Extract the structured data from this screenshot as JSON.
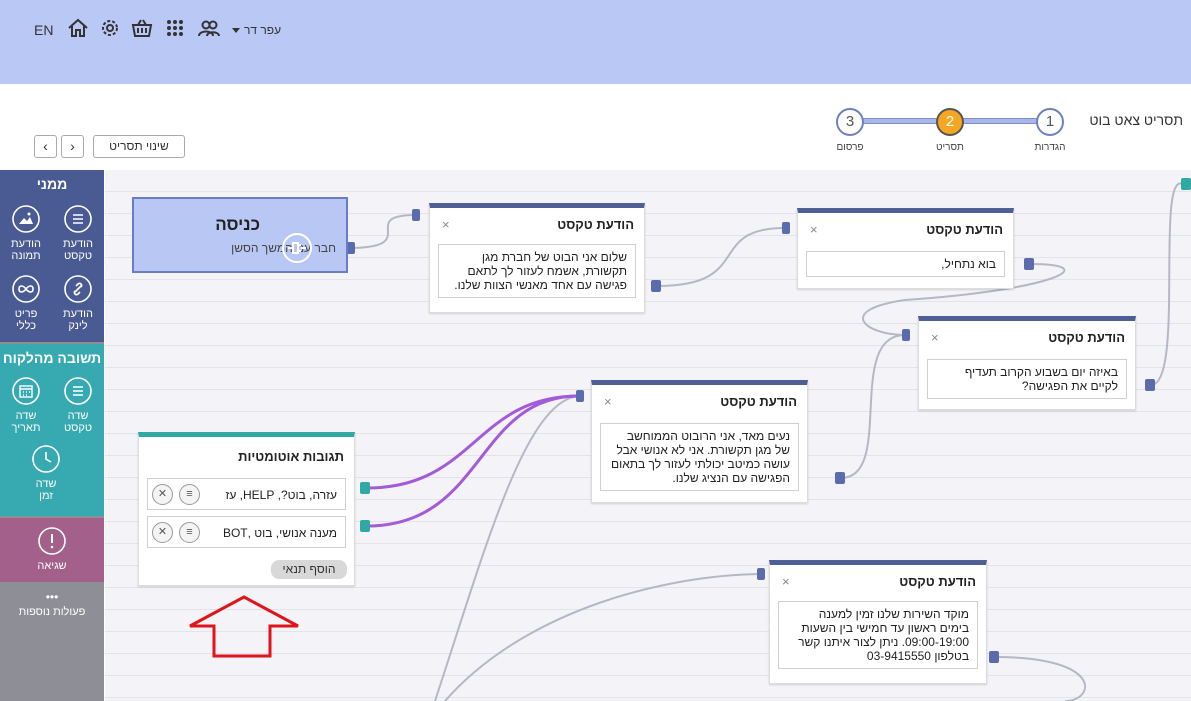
{
  "topbar": {
    "lang": "EN",
    "user_name": "עפר דר",
    "icons": [
      "home-icon",
      "gear-icon",
      "basket-icon",
      "apps-grid-icon",
      "users-icon"
    ]
  },
  "header": {
    "page_title": "תסריט צאט בוט",
    "change_script": "שינוי תסריט",
    "prev": "‹",
    "next": "›"
  },
  "steps": [
    {
      "num": "1",
      "label": "הגדרות"
    },
    {
      "num": "2",
      "label": "תסריט"
    },
    {
      "num": "3",
      "label": "פרסום"
    }
  ],
  "sidebar": {
    "from_me": "ממני",
    "from_customer": "תשובה מהלקוח",
    "items_me": [
      {
        "label1": "הודעת",
        "label2": "טקסט",
        "icon": "text-lines-icon"
      },
      {
        "label1": "הודעת",
        "label2": "תמונה",
        "icon": "image-icon"
      },
      {
        "label1": "הודעת",
        "label2": "לינק",
        "icon": "link-icon"
      },
      {
        "label1": "פריט",
        "label2": "כללי",
        "icon": "infinity-icon"
      }
    ],
    "items_customer": [
      {
        "label1": "שדה",
        "label2": "טקסט",
        "icon": "text-lines-icon"
      },
      {
        "label1": "שדה",
        "label2": "תאריך",
        "icon": "calendar-icon"
      },
      {
        "label1": "שדה",
        "label2": "זמן",
        "icon": "clock-icon"
      }
    ],
    "error": "שגיאה",
    "more": "פעולות נוספות",
    "more_dots": "•••"
  },
  "entry": {
    "title": "כניסה",
    "subtitle": "חבר עם המשך הסשן"
  },
  "nodes": [
    {
      "title": "הודעת טקסט",
      "close": "×",
      "body": "שלום אני הבוט של חברת מגן תקשורת, אשמח לעזור לך לתאם פגישה עם אחד מאנשי הצוות שלנו."
    },
    {
      "title": "הודעת טקסט",
      "close": "×",
      "body": "בוא נתחיל,"
    },
    {
      "title": "הודעת טקסט",
      "close": "×",
      "body": "באיזה יום בשבוע הקרוב תעדיף לקיים את הפגישה?"
    },
    {
      "title": "הודעת טקסט",
      "close": "×",
      "body": "נעים מאד, אני הרובוט הממוחשב של מגן תקשורת. אני לא אנושי אבל עושה כמיטב יכולתי לעזור לך בתאום הפגישה עם הנציג שלנו."
    },
    {
      "title": "הודעת טקסט",
      "close": "×",
      "body": "מוקד השירות שלנו זמין למענה בימים ראשון עד חמישי בין השעות 09:00-19:00. ניתן לצור איתנו קשר בטלפון 03-9415550"
    }
  ],
  "auto": {
    "title": "תגובות אוטומטיות",
    "conditions": [
      "עזרה, בוט?, HELP, עז",
      "מענה אנושי, בוט ,BOT"
    ],
    "add": "הוסף תנאי",
    "remove_glyph": "✕",
    "edit_glyph": "≡"
  },
  "colors": {
    "header": "#b9c8f5",
    "node_top": "#4f5f95",
    "auto_top": "#30a9a3",
    "wire_purple": "#a35bd9",
    "sidebar_blue": "#4a5a93",
    "sidebar_teal": "#36aab0",
    "sidebar_error": "#a2608a",
    "arrow_red": "#e0151b"
  }
}
